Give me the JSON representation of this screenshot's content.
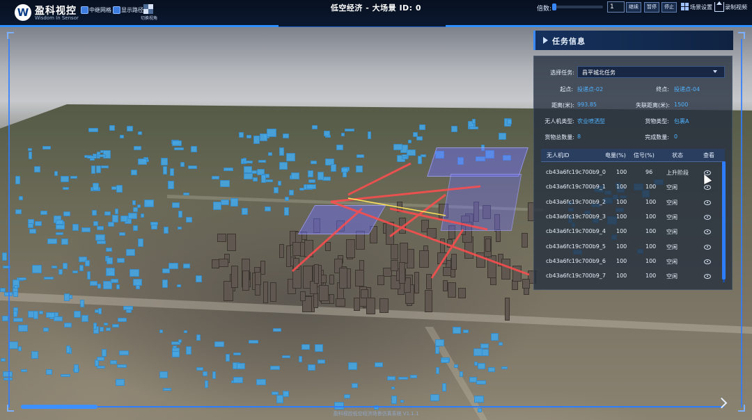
{
  "header": {
    "logo_text": "盈科视控",
    "logo_sub": "Wisdom In Sensor",
    "logo_mark": "W",
    "checkbox_relay_network": "中继网格",
    "checkbox_show_route": "显示路径",
    "camera_view_label": "切换视角",
    "title": "低空经济 - 大场景 ID: 0",
    "speed_label": "倍数:",
    "speed_value": "1",
    "btn_continue": "继续",
    "btn_pause": "暂停",
    "btn_stop": "停止",
    "scene_settings_label": "场景设置",
    "record_label": "录制视频"
  },
  "panel": {
    "title": "任务信息",
    "select_task_label": "选择任务:",
    "select_task_value": "昌平城北任务",
    "start_label": "起点:",
    "start_value": "投递点-02",
    "end_label": "终点:",
    "end_value": "投递点-04",
    "distance_label": "距离(米):",
    "distance_value": "993.85",
    "lost_distance_label": "失联距离(米):",
    "lost_distance_value": "1500",
    "drone_type_label": "无人机类型:",
    "drone_type_value": "农业喷洒型",
    "cargo_type_label": "货物类型:",
    "cargo_type_value": "包裹A",
    "cargo_total_label": "货物总数量:",
    "cargo_total_value": "8",
    "done_count_label": "完成数量:",
    "done_count_value": "0",
    "table": {
      "headers": [
        "无人机ID",
        "电量(%)",
        "信号(%)",
        "状态",
        "查看"
      ],
      "rows": [
        {
          "id": "cb43a6fc19c700b9_0",
          "battery": "100",
          "signal": "96",
          "status": "上升阶段"
        },
        {
          "id": "cb43a6fc19c700b9_1",
          "battery": "100",
          "signal": "100",
          "status": "空闲"
        },
        {
          "id": "cb43a6fc19c700b9_2",
          "battery": "100",
          "signal": "100",
          "status": "空闲"
        },
        {
          "id": "cb43a6fc19c700b9_3",
          "battery": "100",
          "signal": "100",
          "status": "空闲"
        },
        {
          "id": "cb43a6fc19c700b9_4",
          "battery": "100",
          "signal": "100",
          "status": "空闲"
        },
        {
          "id": "cb43a6fc19c700b9_5",
          "battery": "100",
          "signal": "100",
          "status": "空闲"
        },
        {
          "id": "cb43a6fc19c700b9_6",
          "battery": "100",
          "signal": "100",
          "status": "空闲"
        },
        {
          "id": "cb43a6fc19c700b9_7",
          "battery": "100",
          "signal": "100",
          "status": "空闲"
        }
      ]
    }
  },
  "footer": {
    "text": "盈科视控低空经济场景仿真系统 V1.1.1"
  },
  "colors": {
    "accent": "#2f7dff",
    "value_blue": "#4fb2ff",
    "route_red": "#ff4d4d",
    "building_blue": "#46a5e1"
  }
}
